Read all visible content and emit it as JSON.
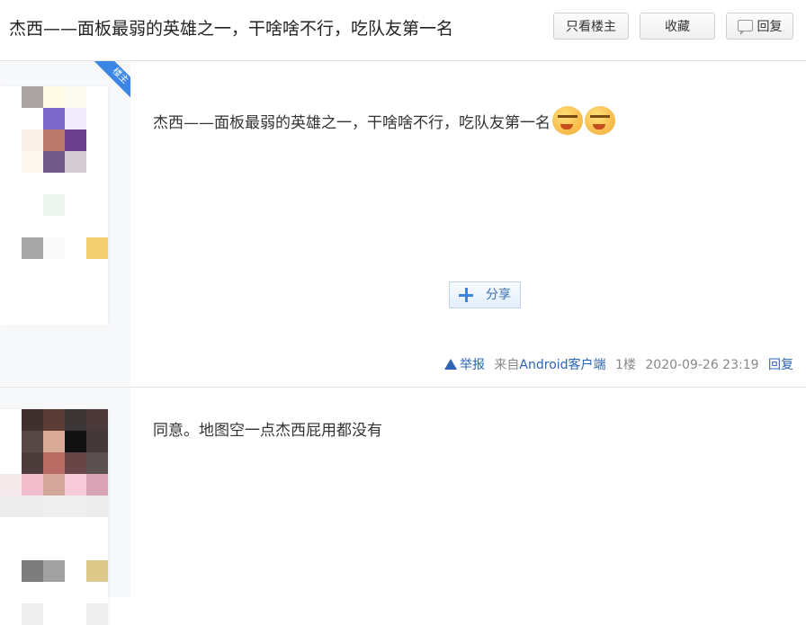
{
  "header": {
    "title": "杰西——面板最弱的英雄之一，干啥啥不行，吃队友第一名",
    "buttons": {
      "only_op": "只看楼主",
      "favorite": "收藏",
      "reply": "回复"
    }
  },
  "posts": [
    {
      "badge": "楼主",
      "content": "杰西——面板最弱的英雄之一，干啥啥不行，吃队友第一名",
      "emojis": [
        "angry-emoji",
        "angry-emoji"
      ],
      "share_label": "分享",
      "report": "举报",
      "source": "来自",
      "client": "Android客户端",
      "floor": "1楼",
      "time": "2020-09-26 23:19",
      "reply": "回复"
    },
    {
      "content": "同意。地图空一点杰西屁用都没有"
    }
  ],
  "colors": {
    "link_blue": "#2d64b3",
    "badge_blue": "#3b85e6",
    "sidebar_bg": "#f7f8fa"
  }
}
